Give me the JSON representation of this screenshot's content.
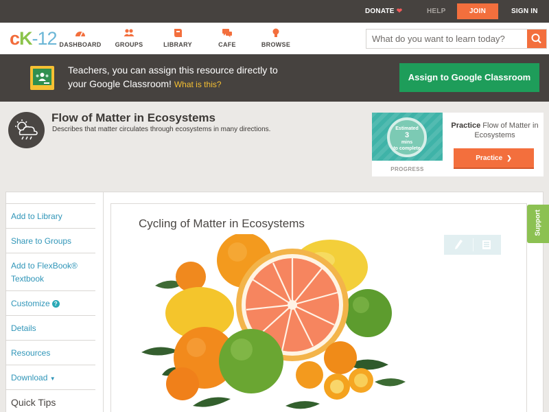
{
  "topbar": {
    "donate": "DONATE",
    "help": "HELP",
    "join": "JOIN",
    "signin": "SIGN IN"
  },
  "logo": {
    "c": "c",
    "k": "K",
    "rest": "-12"
  },
  "nav": {
    "items": [
      {
        "label": "DASHBOARD",
        "icon": "dashboard-icon"
      },
      {
        "label": "GROUPS",
        "icon": "groups-icon"
      },
      {
        "label": "LIBRARY",
        "icon": "library-icon"
      },
      {
        "label": "CAFE",
        "icon": "cafe-icon"
      },
      {
        "label": "BROWSE",
        "icon": "browse-icon"
      }
    ]
  },
  "search": {
    "placeholder": "What do you want to learn today?"
  },
  "classroom": {
    "line1": "Teachers, you can assign this resource directly to",
    "line2": "your Google Classroom!",
    "what": "What is this?",
    "button": "Assign to Google Classroom"
  },
  "page": {
    "title": "Flow of Matter in Ecosystems",
    "description": "Describes that matter circulates through ecosystems in many directions."
  },
  "practice": {
    "estimated": "Estimated",
    "mins_number": "3",
    "mins_word": "mins",
    "complete": "to complete",
    "progress": "PROGRESS",
    "label_bold": "Practice",
    "label_rest": "Flow of Matter in Ecosystems",
    "button": "Practice"
  },
  "sidebar": {
    "add_library": "Add to Library",
    "share_groups": "Share to Groups",
    "flexbook_line1": "Add to FlexBook®",
    "flexbook_line2": "Textbook",
    "customize": "Customize",
    "details": "Details",
    "resources": "Resources",
    "download": "Download",
    "quick_tips": "Quick Tips"
  },
  "content": {
    "title": "Cycling of Matter in Ecosystems"
  },
  "support": "Support",
  "colors": {
    "orange": "#f36f3d",
    "green": "#1e9d5a",
    "teal": "#3fb3a8",
    "link": "#2f95b8",
    "dark": "#46423f"
  }
}
